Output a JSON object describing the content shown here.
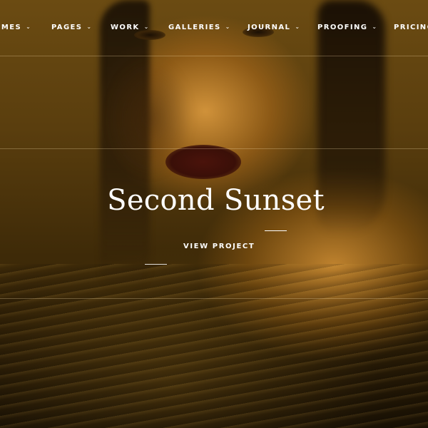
{
  "nav": {
    "items": [
      {
        "label": "OMES",
        "chevron": "⌄"
      },
      {
        "label": "PAGES",
        "chevron": "⌄"
      },
      {
        "label": "WORK",
        "chevron": "⌄"
      },
      {
        "label": "GALLERIES",
        "chevron": "⌄"
      },
      {
        "label": "JOURNAL",
        "chevron": "⌄"
      },
      {
        "label": "PROOFING",
        "chevron": "⌄"
      },
      {
        "label": "PRICING",
        "chevron": ""
      }
    ]
  },
  "hero": {
    "title": "Second Sunset",
    "cta_label": "VIEW PROJECT"
  },
  "colors": {
    "text": "#ffffff",
    "background_tint": "#6b4b12"
  }
}
